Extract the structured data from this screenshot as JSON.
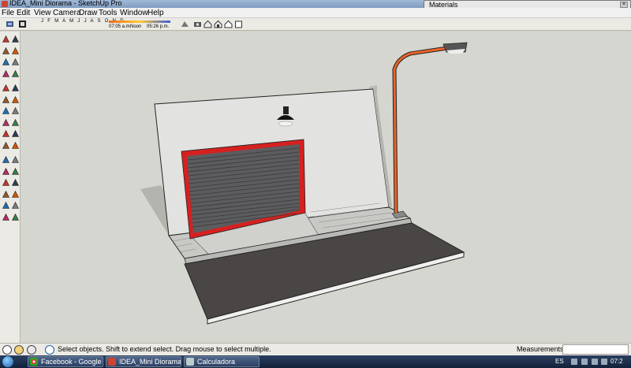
{
  "window": {
    "title": "IDEA_Mini Diorama - SketchUp Pro",
    "icon": "sketchup-icon"
  },
  "menubar": {
    "items": [
      "File",
      "Edit",
      "View",
      "Camera",
      "Draw",
      "Tools",
      "Window",
      "Help"
    ]
  },
  "toolbar": {
    "shadow_months": "J F M A M J J A S O N D",
    "time_start": "07:05 a.m.",
    "time_noon": "Noon",
    "time_end": "05:26 p.m."
  },
  "materials_panel": {
    "title": "Materials",
    "close_icon": "close-icon"
  },
  "palette_tools": [
    "select-icon",
    "component-icon",
    "paint-bucket-icon",
    "eraser-icon",
    "rectangle-icon",
    "line-icon",
    "circle-icon",
    "arc-icon",
    "polygon-icon",
    "freehand-icon",
    "move-icon",
    "push-pull-icon",
    "rotate-icon",
    "follow-me-icon",
    "scale-icon",
    "offset-icon",
    "tape-measure-icon",
    "dimension-icon",
    "protractor-icon",
    "text-icon",
    "axes-icon",
    "3d-text-icon",
    "orbit-icon",
    "pan-icon",
    "zoom-icon",
    "zoom-window-icon",
    "zoom-extents-icon",
    "previous-view-icon",
    "walk-icon",
    "look-around-icon",
    "position-camera-icon",
    "section-plane-icon"
  ],
  "statusbar": {
    "text": "Select objects. Shift to extend select. Drag mouse to select multiple.",
    "measurements_label": "Measurements",
    "measurements_value": ""
  },
  "taskbar": {
    "tasks": [
      {
        "label": "Facebook - Google C...",
        "icon": "chrome-icon"
      },
      {
        "label": "IDEA_Mini Diorama - ...",
        "icon": "sketchup-icon"
      },
      {
        "label": "Calculadora",
        "icon": "calculator-icon"
      }
    ],
    "language": "ES",
    "clock": "07:2"
  },
  "colors": {
    "door_frame": "#d62020",
    "lamp_post": "#e8642a",
    "wall": "#e2e2e0",
    "asphalt": "#4a4646",
    "viewport_bg": "#d6d6d0"
  }
}
